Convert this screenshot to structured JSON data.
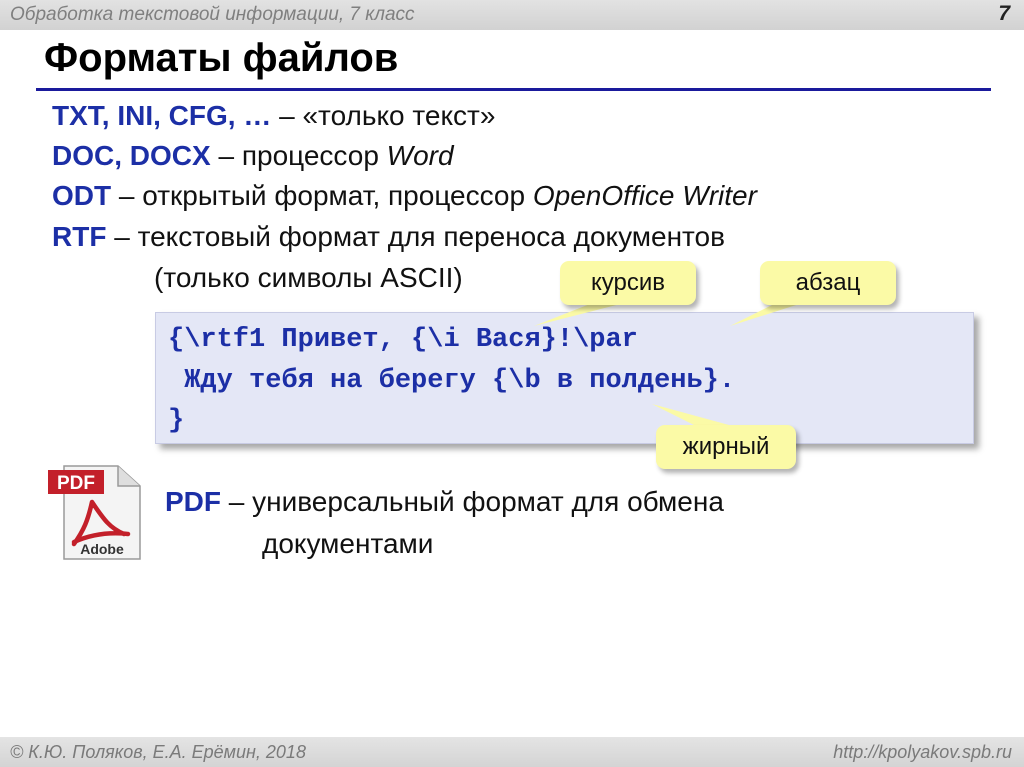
{
  "header": {
    "subject": "Обработка текстовой информации, 7 класс",
    "slide_number": "7"
  },
  "title": "Форматы файлов",
  "formats": [
    {
      "name": "TXT, INI, CFG, …",
      "sep": " – ",
      "desc": "«только текст»"
    },
    {
      "name": "DOC, DOCX",
      "sep": " – ",
      "desc": "процессор ",
      "desc_italic": "Word"
    },
    {
      "name": "ODT",
      "sep": " – ",
      "desc": "открытый формат, процессор ",
      "desc_italic": "OpenOffice Writer"
    },
    {
      "name": "RTF",
      "sep": " – ",
      "desc": "текстовый формат для переноса документов"
    }
  ],
  "rtf_note": "(только символы ASCII)",
  "code": {
    "lines": [
      "{\\rtf1 Привет, {\\i Вася}!\\par",
      " Жду тебя на берегу {\\b в полдень}.",
      "}"
    ]
  },
  "callouts": {
    "italic": "курсив",
    "paragraph": "абзац",
    "bold": "жирный"
  },
  "pdf_icon": {
    "label_top": "PDF",
    "label_bottom": "Adobe",
    "colors": {
      "red": "#c3202a",
      "page": "#f4f4f4"
    }
  },
  "pdf": {
    "name": "PDF",
    "sep": " – ",
    "desc_line1": "универсальный формат для обмена",
    "desc_line2": "документами"
  },
  "footer": {
    "author": "© К.Ю. Поляков, Е.А. Ерёмин, 2018",
    "site": "http://kpolyakov.spb.ru"
  },
  "colors": {
    "accent_blue": "#1c2fa6",
    "rule_blue": "#1a1a9c",
    "code_bg": "#e4e7f6",
    "callout_bg": "#fbfaa6"
  }
}
